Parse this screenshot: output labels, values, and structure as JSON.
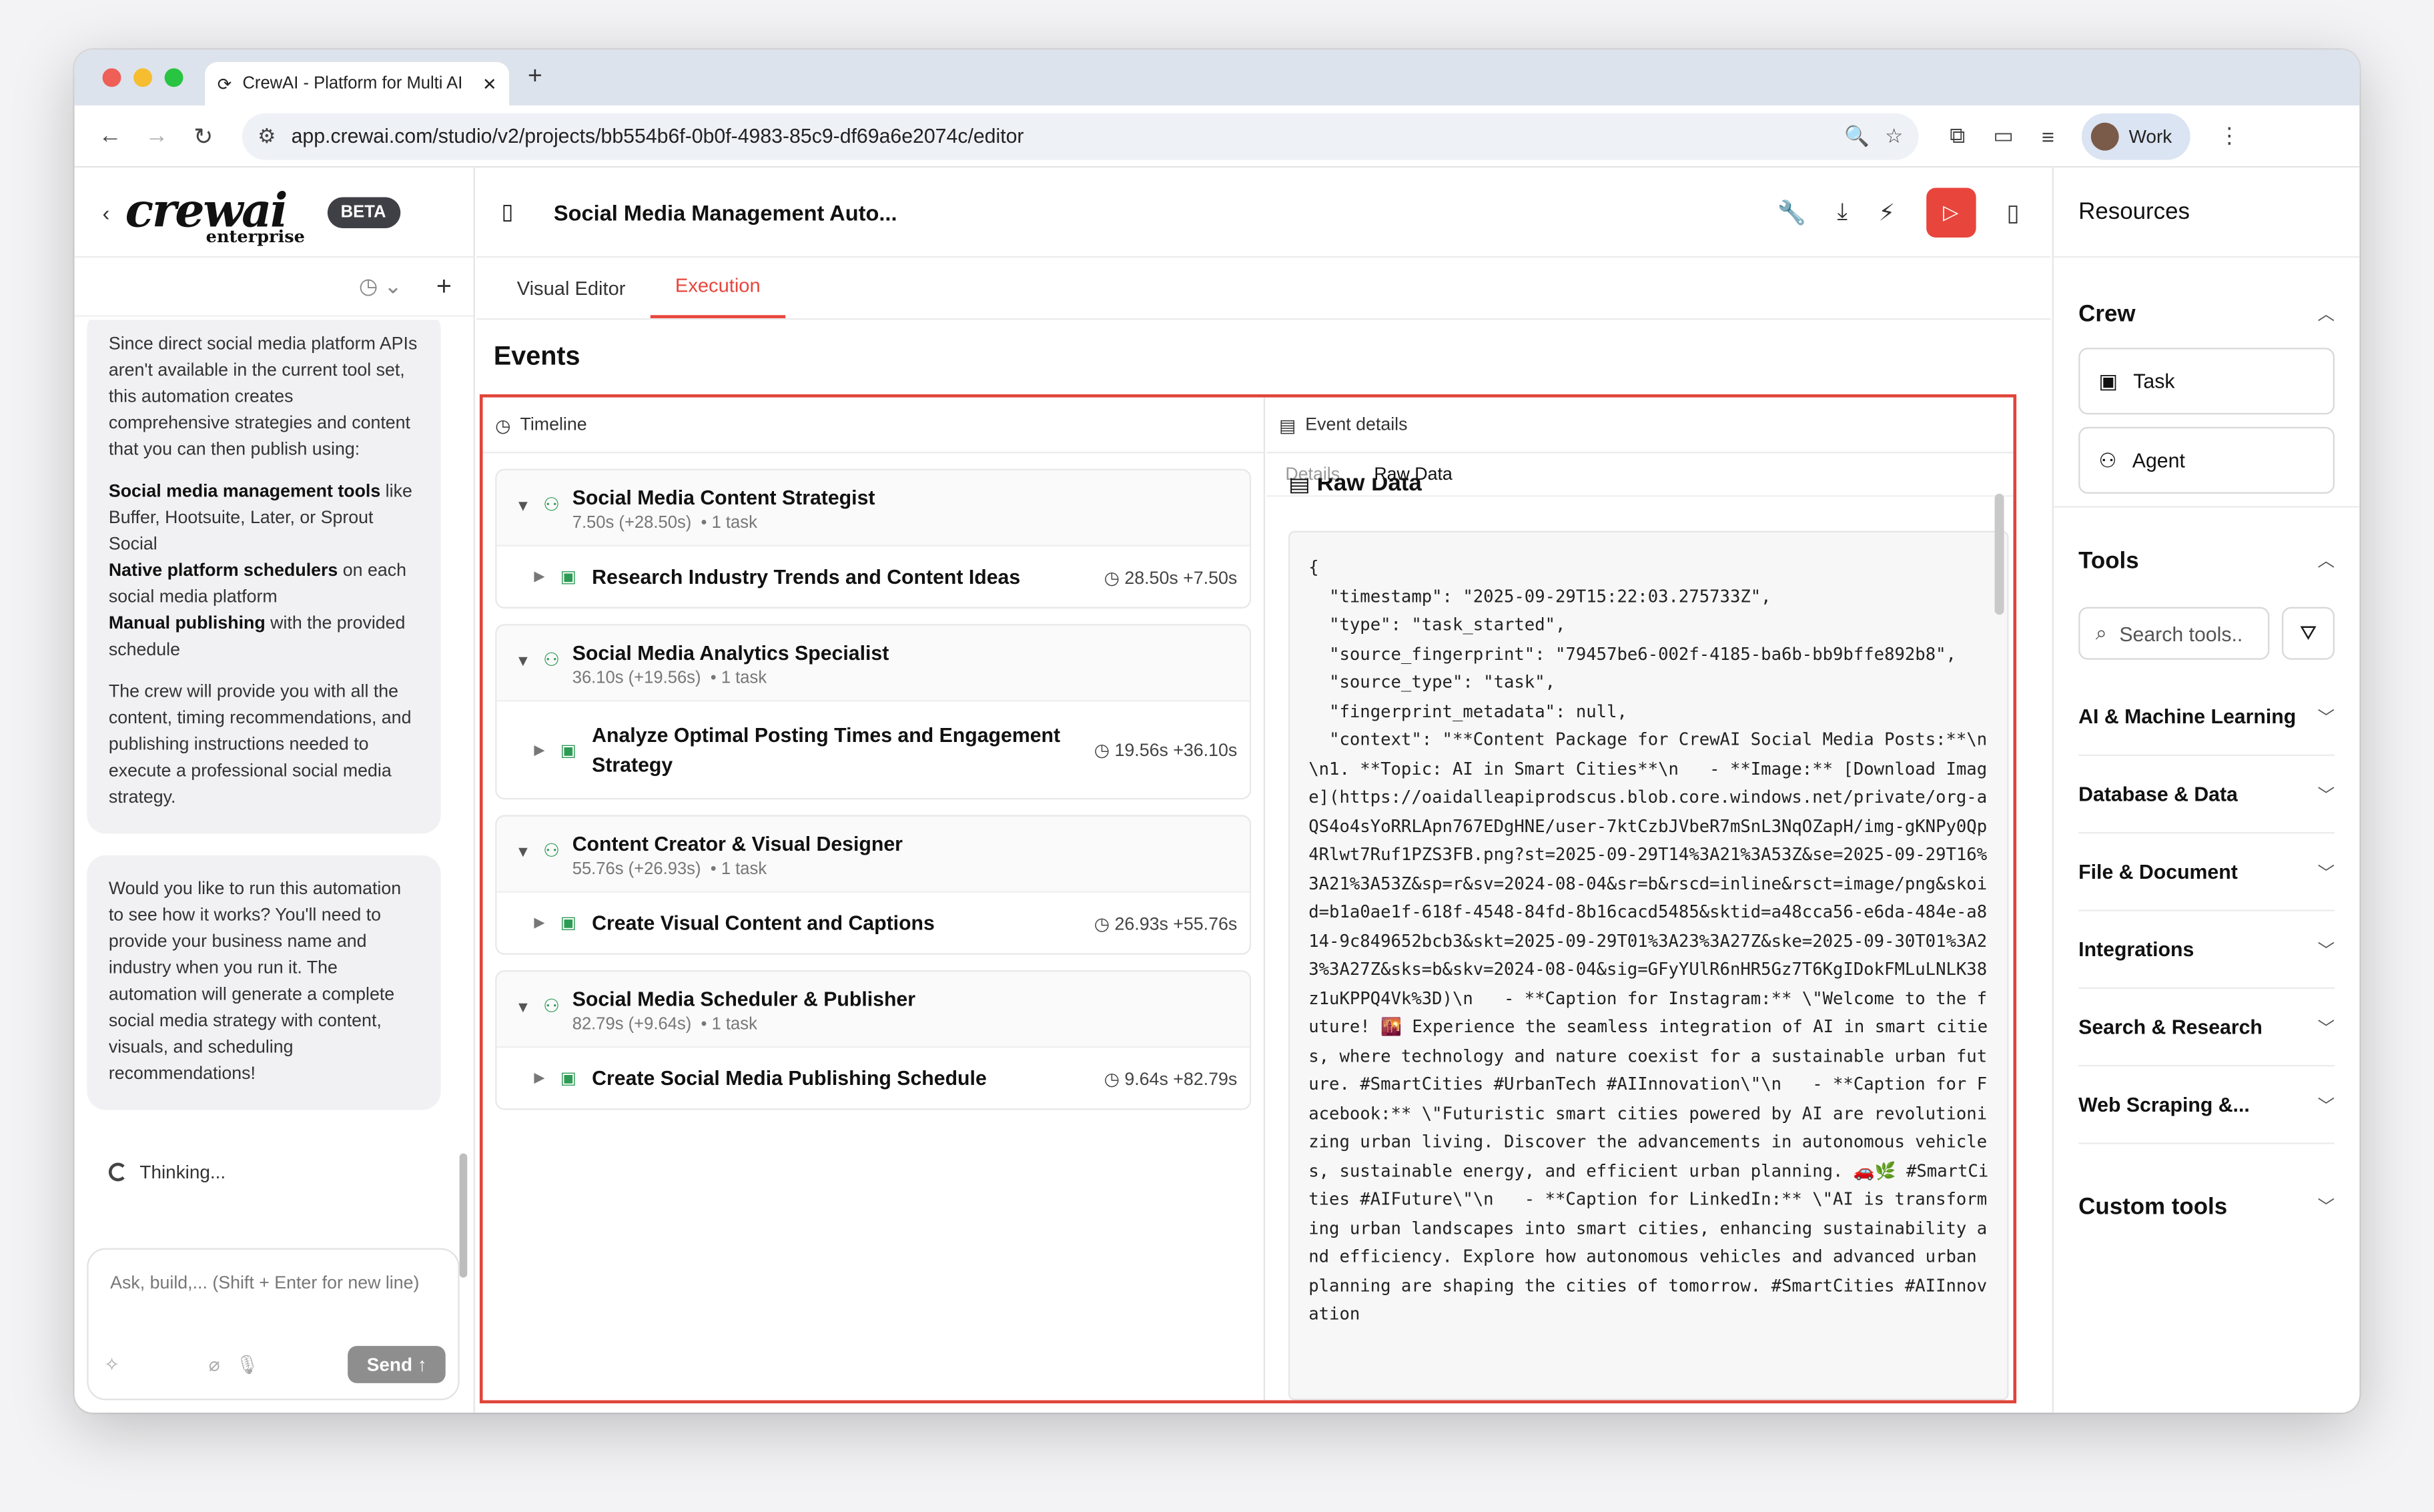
{
  "browser": {
    "tab_title": "CrewAI - Platform for Multi AI",
    "url": "app.crewai.com/studio/v2/projects/bb554b6f-0b0f-4983-85c9-df69a6e2074c/editor",
    "profile_label": "Work"
  },
  "sidebar": {
    "logo_text": "crewai",
    "logo_sub": "enterprise",
    "badge": "BETA",
    "messages": [
      {
        "paragraphs": [
          "Since direct social media platform APIs aren't available in the current tool set, this automation creates comprehensive strategies and content that you can then publish using:",
          {
            "bold": "Social media management tools",
            "rest": " like Buffer, Hootsuite, Later, or Sprout Social"
          },
          {
            "bold": "Native platform schedulers",
            "rest": " on each social media platform"
          },
          {
            "bold": "Manual publishing",
            "rest": " with the provided schedule"
          },
          "The crew will provide you with all the content, timing recommendations, and publishing instructions needed to execute a professional social media strategy."
        ]
      },
      {
        "paragraphs": [
          "Would you like to run this automation to see how it works? You'll need to provide your business name and industry when you run it. The automation will generate a complete social media strategy with content, visuals, and scheduling recommendations!"
        ]
      }
    ],
    "thinking": "Thinking...",
    "input_placeholder": "Ask, build,... (Shift + Enter for new line)",
    "send_label": "Send"
  },
  "header": {
    "title": "Social Media Management Auto...",
    "tabs": [
      "Visual Editor",
      "Execution"
    ],
    "active_tab": "Execution"
  },
  "events": {
    "heading": "Events",
    "timeline_label": "Timeline",
    "details_label": "Event details",
    "detail_tabs": [
      "Details",
      "Raw Data"
    ],
    "raw_title": "Raw Data",
    "agents": [
      {
        "name": "Social Media Content Strategist",
        "time": "7.50s (+28.50s)",
        "tasks": "1 task",
        "task": "Research Industry Trends and Content Ideas",
        "task_time": "28.50s +7.50s"
      },
      {
        "name": "Social Media Analytics Specialist",
        "time": "36.10s (+19.56s)",
        "tasks": "1 task",
        "task": "Analyze Optimal Posting Times and Engagement Strategy",
        "task_time": "19.56s +36.10s"
      },
      {
        "name": "Content Creator & Visual Designer",
        "time": "55.76s (+26.93s)",
        "tasks": "1 task",
        "task": "Create Visual Content and Captions",
        "task_time": "26.93s +55.76s"
      },
      {
        "name": "Social Media Scheduler & Publisher",
        "time": "82.79s (+9.64s)",
        "tasks": "1 task",
        "task": "Create Social Media Publishing Schedule",
        "task_time": "9.64s +82.79s"
      }
    ],
    "raw_json": "{\n  \"timestamp\": \"2025-09-29T15:22:03.275733Z\",\n  \"type\": \"task_started\",\n  \"source_fingerprint\": \"79457be6-002f-4185-ba6b-bb9bffe892b8\",\n  \"source_type\": \"task\",\n  \"fingerprint_metadata\": null,\n  \"context\": \"**Content Package for CrewAI Social Media Posts:**\\n\\n1. **Topic: AI in Smart Cities**\\n   - **Image:** [Download Image](https://oaidalleapiprodscus.blob.core.windows.net/private/org-aQS4o4sYoRRLApn767EDgHNE/user-7ktCzbJVbeR7mSnL3NqOZapH/img-gKNPy0Qp4Rlwt7Ruf1PZS3FB.png?st=2025-09-29T14%3A21%3A53Z&se=2025-09-29T16%3A21%3A53Z&sp=r&sv=2024-08-04&sr=b&rscd=inline&rsct=image/png&skoid=b1a0ae1f-618f-4548-84fd-8b16cacd5485&sktid=a48cca56-e6da-484e-a814-9c849652bcb3&skt=2025-09-29T01%3A23%3A27Z&ske=2025-09-30T01%3A23%3A27Z&sks=b&skv=2024-08-04&sig=GFyYUlR6nHR5Gz7T6KgIDokFMLuLNLK38z1uKPPQ4Vk%3D)\\n   - **Caption for Instagram:** \\\"Welcome to the future! 🌇 Experience the seamless integration of AI in smart cities, where technology and nature coexist for a sustainable urban future. #SmartCities #UrbanTech #AIInnovation\\\"\\n   - **Caption for Facebook:** \\\"Futuristic smart cities powered by AI are revolutionizing urban living. Discover the advancements in autonomous vehicles, sustainable energy, and efficient urban planning. 🚗🌿 #SmartCities #AIFuture\\\"\\n   - **Caption for LinkedIn:** \\\"AI is transforming urban landscapes into smart cities, enhancing sustainability and efficiency. Explore how autonomous vehicles and advanced urban planning are shaping the cities of tomorrow. #SmartCities #AIInnovation"
  },
  "resources": {
    "title": "Resources",
    "crew_label": "Crew",
    "crew_items": [
      "Task",
      "Agent"
    ],
    "tools_label": "Tools",
    "search_placeholder": "Search tools..",
    "categories": [
      "AI & Machine Learning",
      "Database & Data",
      "File & Document",
      "Integrations",
      "Search & Research",
      "Web Scraping &..."
    ],
    "custom_tools_label": "Custom tools"
  }
}
